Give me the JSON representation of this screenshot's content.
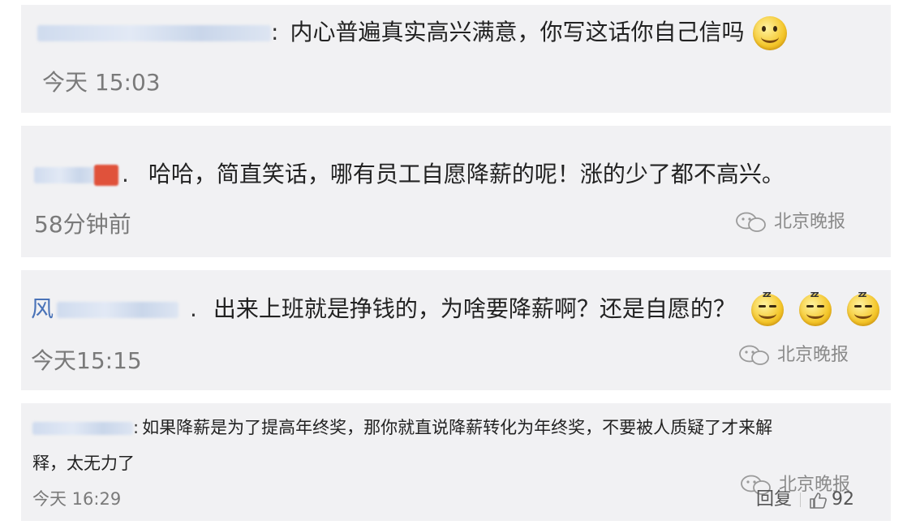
{
  "comments": [
    {
      "colon": ":",
      "text": "内心普遍真实高兴满意，你写这话你自己信吗",
      "time": "今天 15:03"
    },
    {
      "colon": ".",
      "text": "哈哈，简直笑话，哪有员工自愿降薪的呢！涨的少了都不高兴。",
      "time": "58分钟前",
      "watermark": "北京晚报"
    },
    {
      "name_prefix": "风",
      "colon": ".",
      "text": "出来上班就是挣钱的，为啥要降薪啊？还是自愿的？",
      "time": "今天15:15",
      "watermark": "北京晚报"
    },
    {
      "colon": ":",
      "text_line1": "如果降薪是为了提高年终奖，那你就直说降薪转化为年终奖，不要被人质疑了才来解",
      "text_line2": "释，太无力了",
      "time": "今天 16:29",
      "watermark": "北京晚报",
      "reply_label": "回复",
      "like_count": "92"
    }
  ],
  "icons": {
    "smile": "smile-emoji-icon",
    "sleepy": "sleepy-emoji-icon",
    "wechat": "wechat-icon",
    "like": "thumbs-up-icon"
  },
  "colors": {
    "card_bg": "#f1f1f3",
    "username_blue": "#4a73b8",
    "time_gray": "#7a7a7a",
    "emoji_yellow": "#f4c62a"
  }
}
